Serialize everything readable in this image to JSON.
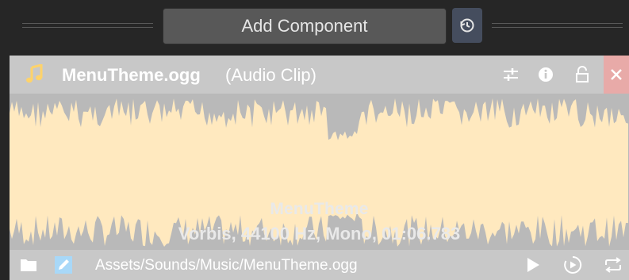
{
  "toolbar": {
    "add_component_label": "Add Component",
    "history_icon": "history-icon"
  },
  "clip": {
    "file_name": "MenuTheme.ogg",
    "type_label": "(Audio Clip)",
    "display_name": "MenuTheme",
    "format_info": "Vorbis, 44100 Hz, Mono, 01:06.783",
    "path": "Assets/Sounds/Music/MenuTheme.ogg"
  },
  "header_icons": [
    "music-note-icon",
    "presets-icon",
    "info-icon",
    "lock-icon",
    "close-icon"
  ],
  "footer_icons": [
    "folder-icon",
    "edit-icon",
    "play-icon",
    "autoplay-icon",
    "loop-icon"
  ],
  "colors": {
    "waveform": "#ffe9bf",
    "waveform_bg": "#b9b9b9",
    "header_bg": "#c8c8c8",
    "close_bg": "#e8aaa8",
    "music_icon": "#ffd36a",
    "dark_bg": "#262626"
  }
}
